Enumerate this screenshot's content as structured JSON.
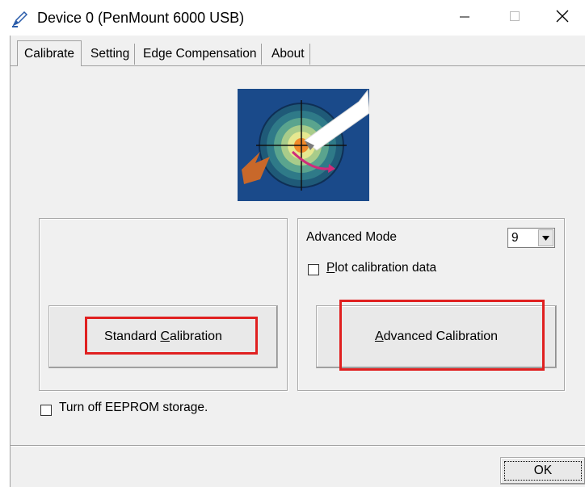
{
  "window": {
    "title": "Device 0 (PenMount 6000 USB)",
    "icon": "pen-calibration-icon",
    "controls": {
      "minimize_icon": "minimize-icon",
      "maximize_icon": "maximize-icon",
      "close_icon": "close-icon"
    }
  },
  "tabs": [
    {
      "label": "Calibrate",
      "active": true
    },
    {
      "label": "Setting",
      "active": false
    },
    {
      "label": "Edge Compensation",
      "active": false
    },
    {
      "label": "About",
      "active": false
    }
  ],
  "calibrate": {
    "logo": "target-pen-logo",
    "standard_button": "Standard Calibration",
    "standard_button_mnemonic": "C",
    "advanced_mode_label": "Advanced Mode",
    "advanced_mode_value": "9",
    "plot_checkbox_label": "Plot calibration data",
    "plot_checked": false,
    "advanced_button": "Advanced Calibration",
    "advanced_button_mnemonic": "A",
    "eeprom_checkbox_label": "Turn off EEPROM storage.",
    "eeprom_checked": false
  },
  "footer": {
    "ok_button": "OK"
  },
  "colors": {
    "highlight": "#e02020",
    "logo_background": "#1a4a8a"
  }
}
